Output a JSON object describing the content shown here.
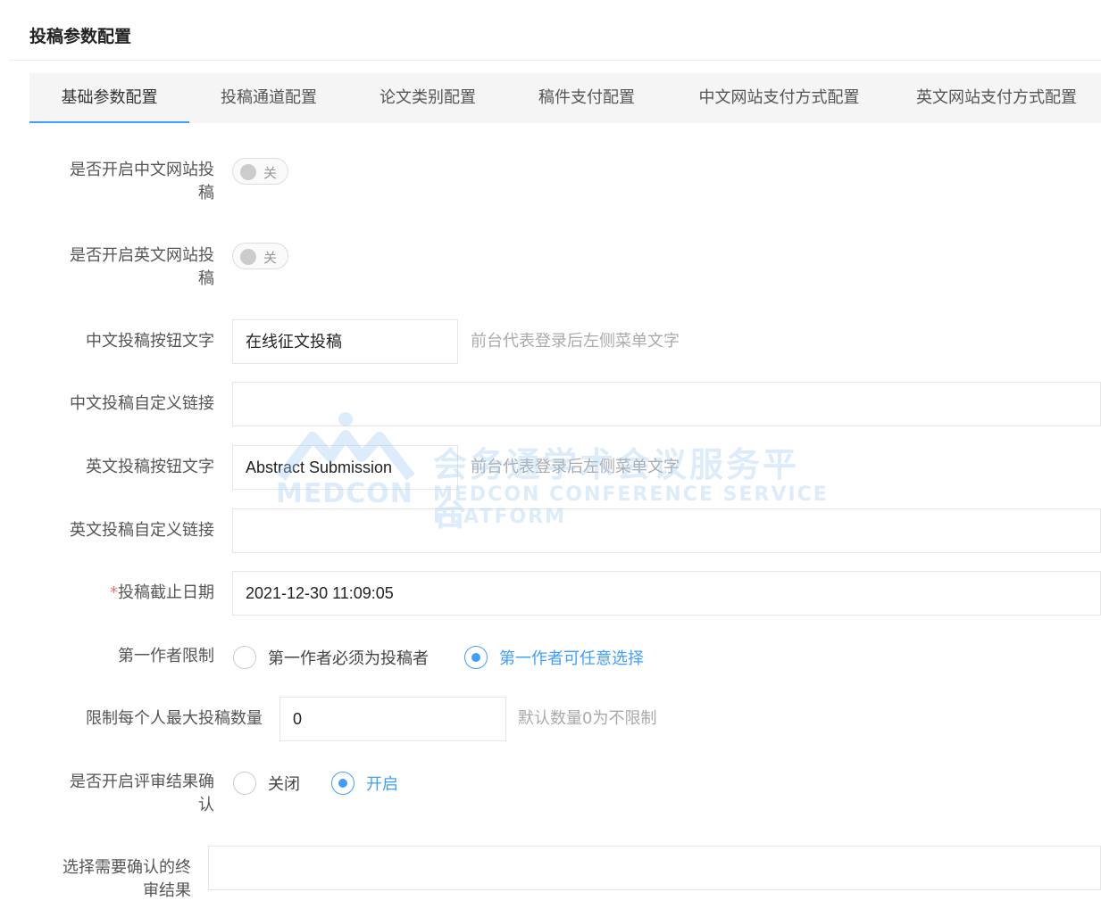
{
  "page": {
    "title": "投稿参数配置"
  },
  "tabs": [
    {
      "label": "基础参数配置",
      "active": true
    },
    {
      "label": "投稿通道配置",
      "active": false
    },
    {
      "label": "论文类别配置",
      "active": false
    },
    {
      "label": "稿件支付配置",
      "active": false
    },
    {
      "label": "中文网站支付方式配置",
      "active": false
    },
    {
      "label": "英文网站支付方式配置",
      "active": false
    }
  ],
  "form": {
    "cn_submit": {
      "label_line1": "是否开启中文网站投",
      "label_line2": "稿",
      "switch_text": "关",
      "enabled": false
    },
    "en_submit": {
      "label_line1": "是否开启英文网站投",
      "label_line2": "稿",
      "switch_text": "关",
      "enabled": false
    },
    "cn_button_text": {
      "label": "中文投稿按钮文字",
      "value": "在线征文投稿",
      "hint": "前台代表登录后左侧菜单文字"
    },
    "cn_custom_link": {
      "label": "中文投稿自定义链接",
      "value": ""
    },
    "en_button_text": {
      "label": "英文投稿按钮文字",
      "value": "Abstract Submission",
      "hint": "前台代表登录后左侧菜单文字"
    },
    "en_custom_link": {
      "label": "英文投稿自定义链接",
      "value": ""
    },
    "deadline": {
      "required_mark": "*",
      "label": "投稿截止日期",
      "value": "2021-12-30 11:09:05"
    },
    "first_author": {
      "label": "第一作者限制",
      "option1": "第一作者必须为投稿者",
      "option2": "第一作者可任意选择",
      "selected": 2
    },
    "max_count": {
      "label": "限制每个人最大投稿数量",
      "value": "0",
      "hint": "默认数量0为不限制"
    },
    "review_confirm": {
      "label_line1": "是否开启评审结果确",
      "label_line2": "认",
      "option1": "关闭",
      "option2": "开启",
      "selected": 2
    },
    "final_result": {
      "label_line1": "选择需要确认的终",
      "label_line2": "审结果",
      "value": ""
    }
  },
  "watermark": {
    "brand": "MEDCON",
    "cn": "会务通学术会议服务平台",
    "en": "MEDCON CONFERENCE SERVICE PLATFORM",
    "color": "#9ecbf2"
  },
  "colors": {
    "accent": "#409eff",
    "required": "#f56c6c"
  }
}
